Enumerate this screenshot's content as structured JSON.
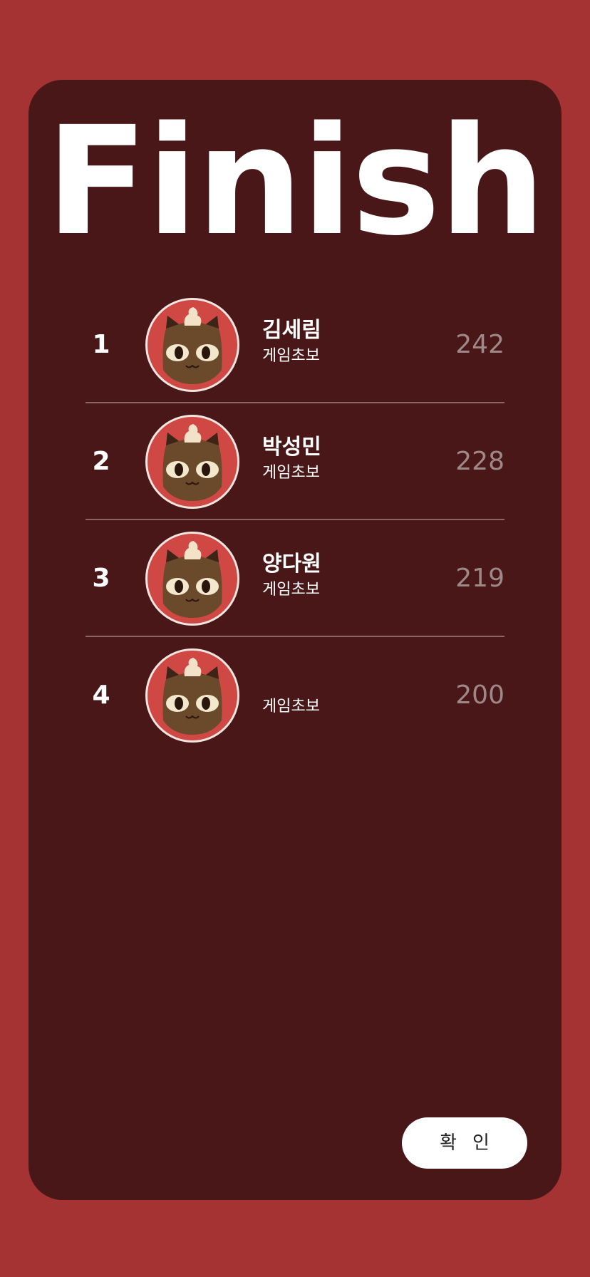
{
  "title": "Finish",
  "players": [
    {
      "rank": "1",
      "name": "김세림",
      "title": "게임초보",
      "score": "242"
    },
    {
      "rank": "2",
      "name": "박성민",
      "title": "게임초보",
      "score": "228"
    },
    {
      "rank": "3",
      "name": "양다원",
      "title": "게임초보",
      "score": "219"
    },
    {
      "rank": "4",
      "name": "",
      "title": "게임초보",
      "score": "200"
    }
  ],
  "confirm_label": "확인",
  "colors": {
    "background": "#a53334",
    "card": "#4a1718",
    "avatar_bg": "#cf4843",
    "score": "#9e8988",
    "divider": "#8e6565"
  },
  "icons": {
    "avatar": "cat-avatar-icon"
  }
}
